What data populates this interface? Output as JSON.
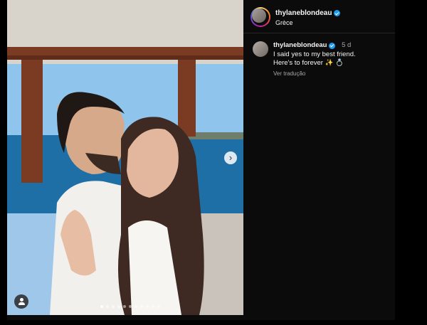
{
  "post": {
    "username": "thylaneblondeau",
    "location": "Grèce",
    "carousel_total_dots": 11,
    "carousel_active_index": 0
  },
  "caption": {
    "username": "thylaneblondeau",
    "time": "5 d",
    "line1": "I said yes to my best friend.",
    "line2": "Here's to forever ✨ 💍",
    "translate": "Ver tradução"
  },
  "icons": {
    "next": "chevron-right-icon",
    "tag": "user-tag-icon",
    "verified": "verified-badge-icon"
  },
  "colors": {
    "verified": "#1d9bf0",
    "background": "#0b0b0b",
    "secondary_text": "#a8a8a8"
  }
}
